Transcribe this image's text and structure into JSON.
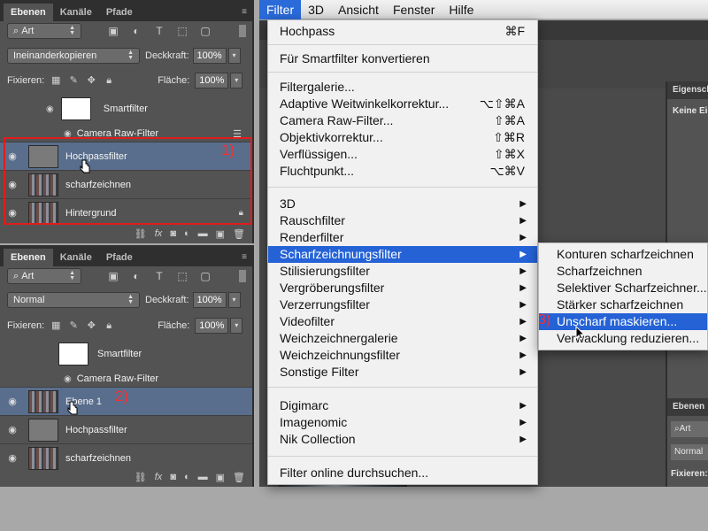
{
  "panel1": {
    "tabs": [
      "Ebenen",
      "Kanäle",
      "Pfade"
    ],
    "filter_kind": "Art",
    "blend_mode": "Ineinanderkopieren",
    "opacity_label": "Deckkraft:",
    "opacity_value": "100%",
    "lock_label": "Fixieren:",
    "fill_label": "Fläche:",
    "fill_value": "100%",
    "smartfilter_label": "Smartfilter",
    "camera_raw_label": "Camera Raw-Filter",
    "layers": [
      "Hochpassfilter",
      "scharfzeichnen",
      "Hintergrund"
    ],
    "annotation": "1)"
  },
  "panel2": {
    "tabs": [
      "Ebenen",
      "Kanäle",
      "Pfade"
    ],
    "filter_kind": "Art",
    "blend_mode": "Normal",
    "opacity_label": "Deckkraft:",
    "opacity_value": "100%",
    "lock_label": "Fixieren:",
    "fill_label": "Fläche:",
    "fill_value": "100%",
    "smartfilter_label": "Smartfilter",
    "camera_raw_label": "Camera Raw-Filter",
    "layers": [
      "Ebene 1",
      "Hochpassfilter",
      "scharfzeichnen"
    ],
    "annotation": "2)"
  },
  "menubar": {
    "items": [
      "Filter",
      "3D",
      "Ansicht",
      "Fenster",
      "Hilfe"
    ]
  },
  "filter_menu": {
    "items": [
      {
        "label": "Hochpass",
        "shortcut": "⌘F"
      },
      {
        "label": "Für Smartfilter konvertieren",
        "shortcut": ""
      },
      {
        "label": "Filtergalerie...",
        "shortcut": ""
      },
      {
        "label": "Adaptive Weitwinkelkorrektur...",
        "shortcut": "⌥⇧⌘A"
      },
      {
        "label": "Camera Raw-Filter...",
        "shortcut": "⇧⌘A"
      },
      {
        "label": "Objektivkorrektur...",
        "shortcut": "⇧⌘R"
      },
      {
        "label": "Verflüssigen...",
        "shortcut": "⇧⌘X"
      },
      {
        "label": "Fluchtpunkt...",
        "shortcut": "⌥⌘V"
      },
      {
        "label": "3D",
        "shortcut": ""
      },
      {
        "label": "Rauschfilter",
        "shortcut": ""
      },
      {
        "label": "Renderfilter",
        "shortcut": ""
      },
      {
        "label": "Scharfzeichnungsfilter",
        "shortcut": ""
      },
      {
        "label": "Stilisierungsfilter",
        "shortcut": ""
      },
      {
        "label": "Vergröberungsfilter",
        "shortcut": ""
      },
      {
        "label": "Verzerrungsfilter",
        "shortcut": ""
      },
      {
        "label": "Videofilter",
        "shortcut": ""
      },
      {
        "label": "Weichzeichnergalerie",
        "shortcut": ""
      },
      {
        "label": "Weichzeichnungsfilter",
        "shortcut": ""
      },
      {
        "label": "Sonstige Filter",
        "shortcut": ""
      },
      {
        "label": "Digimarc",
        "shortcut": ""
      },
      {
        "label": "Imagenomic",
        "shortcut": ""
      },
      {
        "label": "Nik Collection",
        "shortcut": ""
      },
      {
        "label": "Filter online durchsuchen...",
        "shortcut": ""
      }
    ],
    "submenu_arrow": "▶"
  },
  "sharpen_submenu": {
    "items": [
      "Konturen scharfzeichnen",
      "Scharfzeichnen",
      "Selektiver Scharfzeichner...",
      "Stärker scharfzeichnen",
      "Unscharf maskieren...",
      "Verwacklung reduzieren..."
    ],
    "annotation": "3)"
  },
  "right_panel": {
    "tab": "Eigenschaften",
    "line": "Keine Eigenschaften",
    "layers_tab": "Ebenen",
    "filter_kind": "Art",
    "blend_mode": "Normal",
    "lock_label": "Fixieren:"
  }
}
